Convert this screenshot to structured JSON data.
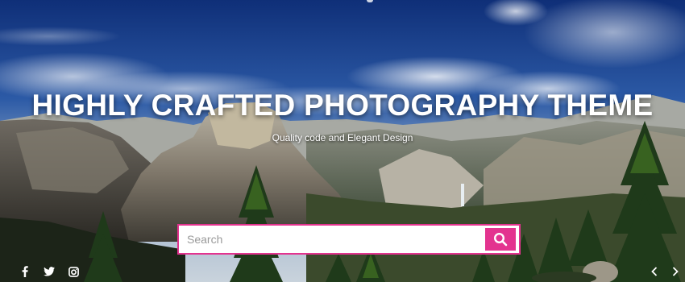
{
  "hero": {
    "headline": "HIGHLY CRAFTED PHOTOGRAPHY THEME",
    "tagline": "Quality code and Elegant Design"
  },
  "search": {
    "placeholder": "Search",
    "button_icon": "search-icon"
  },
  "social": {
    "icons": [
      "facebook-icon",
      "twitter-icon",
      "instagram-icon"
    ]
  },
  "slider": {
    "prev_icon": "chevron-left-icon",
    "next_icon": "chevron-right-icon"
  },
  "colors": {
    "accent": "#e3338f",
    "sky_top": "#163a86",
    "sky_mid": "#2e5ba5",
    "forest": "#1f3a1a"
  }
}
